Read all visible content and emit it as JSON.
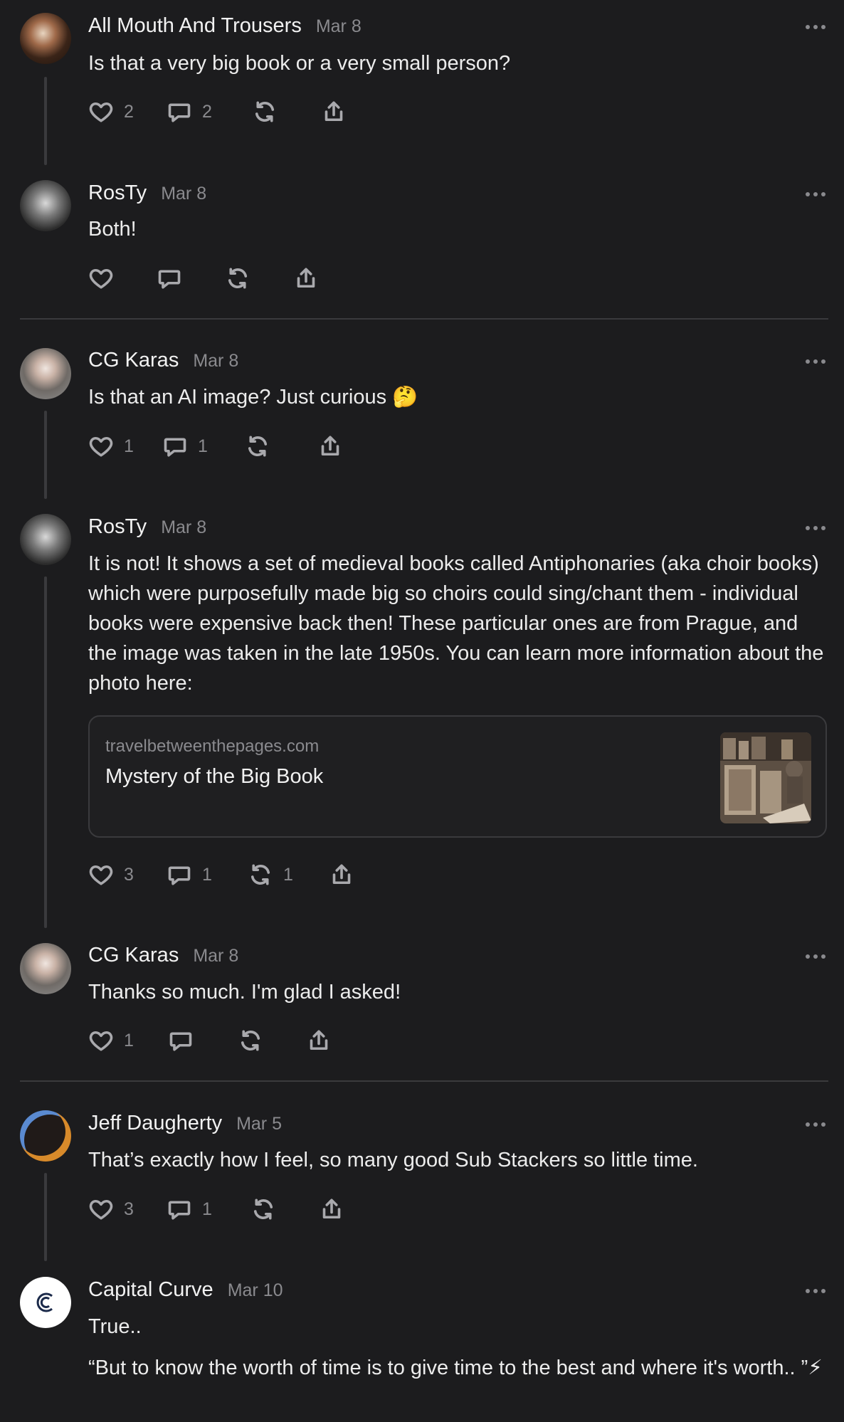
{
  "comments": [
    {
      "author": "All Mouth And Trousers",
      "date": "Mar 8",
      "text": "Is that a very big book or a very small person?",
      "likes": "2",
      "replies": "2",
      "restacks": ""
    },
    {
      "author": "RosTy",
      "date": "Mar 8",
      "text": "Both!",
      "likes": "",
      "replies": "",
      "restacks": ""
    },
    {
      "author": "CG Karas",
      "date": "Mar 8",
      "text": "Is that an AI image? Just curious 🤔",
      "likes": "1",
      "replies": "1",
      "restacks": ""
    },
    {
      "author": "RosTy",
      "date": "Mar 8",
      "text": "It is not! It shows a set of medieval books called Antiphonaries (aka choir books) which were purposefully made big so choirs could sing/chant them - individual books were expensive back then! These particular ones are from Prague, and the image was taken in the late 1950s. You can learn more information about the photo here:",
      "likes": "3",
      "replies": "1",
      "restacks": "1",
      "link": {
        "domain": "travelbetweenthepages.com",
        "title": "Mystery of the Big Book"
      }
    },
    {
      "author": "CG Karas",
      "date": "Mar 8",
      "text": "Thanks so much. I'm glad I asked!",
      "likes": "1",
      "replies": "",
      "restacks": ""
    },
    {
      "author": "Jeff Daugherty",
      "date": "Mar 5",
      "text": "That’s exactly how I feel, so many good Sub Stackers so little time.",
      "likes": "3",
      "replies": "1",
      "restacks": ""
    },
    {
      "author": "Capital Curve",
      "date": "Mar 10",
      "text": "True..",
      "text2": "“But to know the worth of time is to give time to the best and where it's worth.. ”⚡",
      "likes": "",
      "replies": "",
      "restacks": ""
    }
  ],
  "icons": {
    "like": "heart-icon",
    "reply": "comment-bubble-icon",
    "restack": "restack-icon",
    "share": "share-icon",
    "more": "more-dots-icon"
  },
  "colors": {
    "background": "#1c1c1e",
    "text": "#ececec",
    "muted": "#8a8a8e",
    "divider": "#3a3a3d"
  }
}
